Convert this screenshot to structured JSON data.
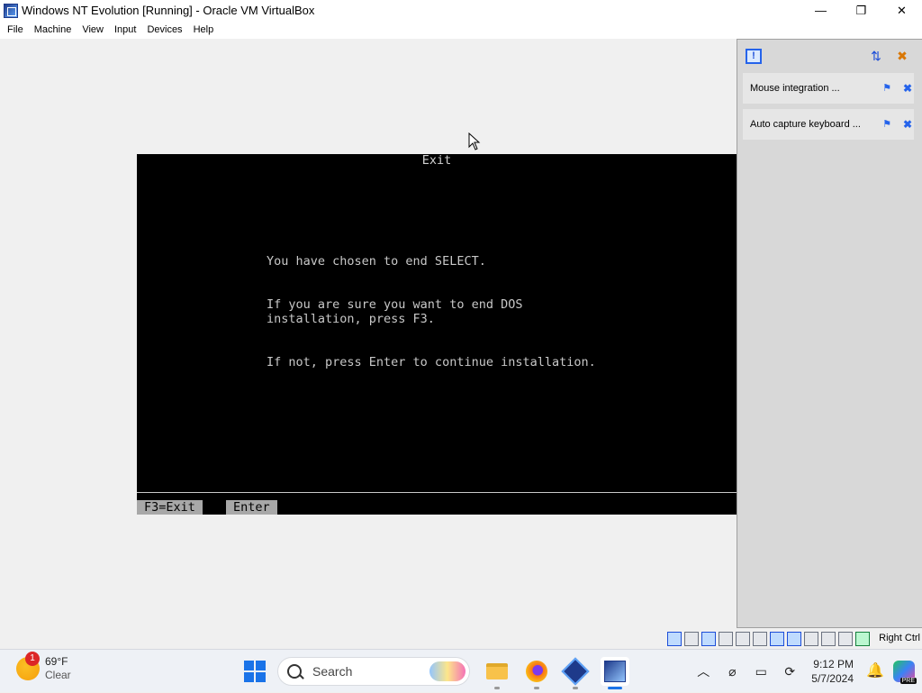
{
  "window": {
    "title": "Windows NT Evolution [Running] - Oracle VM VirtualBox",
    "icon": "virtualbox-vm-icon",
    "controls": {
      "minimize": "—",
      "maximize": "❐",
      "close": "✕"
    }
  },
  "menu": {
    "items": [
      "File",
      "Machine",
      "View",
      "Input",
      "Devices",
      "Help"
    ]
  },
  "vm_screen": {
    "title": "Exit",
    "lines": [
      "You have chosen to end SELECT.",
      "If you are sure you want to end DOS",
      "installation, press F3.",
      "If not, press Enter to continue installation."
    ],
    "status_keys": [
      "F3=Exit",
      "Enter"
    ]
  },
  "notification_panel": {
    "items": [
      {
        "text": "Mouse integration ..."
      },
      {
        "text": "Auto capture keyboard ..."
      }
    ],
    "icons": {
      "info": "!",
      "toggle": "⇅",
      "close_all": "✖",
      "pin": "⚑",
      "close": "✖"
    }
  },
  "statusbar": {
    "host_key": "Right Ctrl"
  },
  "taskbar": {
    "weather": {
      "badge": "1",
      "temp": "69°F",
      "condition": "Clear"
    },
    "search_placeholder": "Search",
    "apps": [
      "file-explorer",
      "firefox",
      "virtualbox",
      "windows-nt-vm"
    ],
    "tray": {
      "chevron": "︿",
      "net": "⌀",
      "display": "▭",
      "sync": "⟳"
    },
    "clock": {
      "time": "9:12 PM",
      "date": "5/7/2024"
    },
    "bell": "🔔",
    "copilot_badge": "PRE"
  },
  "colors": {
    "vm_text": "#c8c8c8",
    "vm_bg": "#000000",
    "accent": "#1a73e8"
  }
}
